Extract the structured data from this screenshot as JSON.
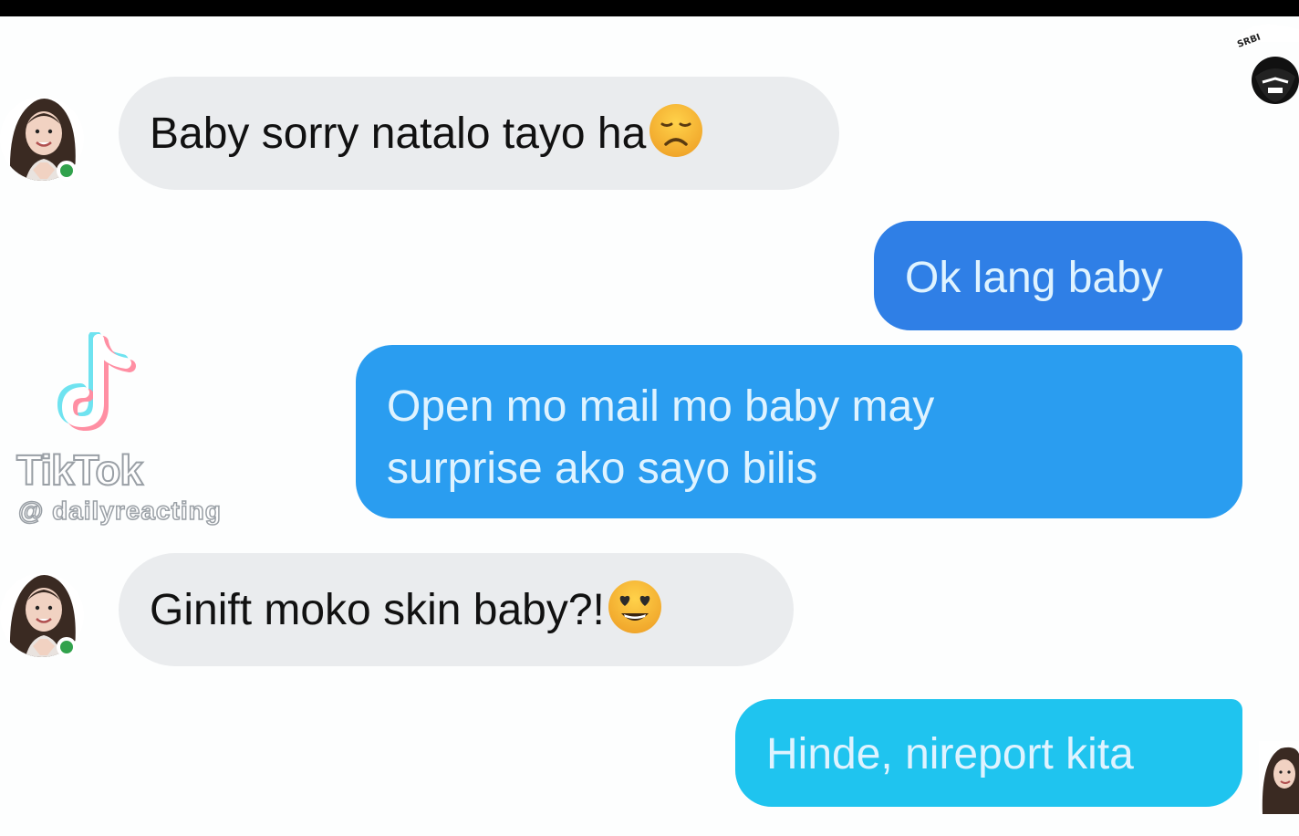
{
  "messages": [
    {
      "side": "received",
      "text": "Baby sorry natalo tayo ha",
      "emoji": "disappointed-face"
    },
    {
      "side": "sent",
      "text": "Ok lang baby"
    },
    {
      "side": "sent",
      "line1": "Open mo mail mo baby may",
      "line2": "surprise ako sayo bilis"
    },
    {
      "side": "received",
      "text": "Ginift moko skin baby?!",
      "emoji": "heart-eyes-face"
    },
    {
      "side": "sent",
      "text": "Hinde, nireport kita"
    }
  ],
  "watermark": {
    "brand": "TikTok",
    "handle": "@ dailyreacting"
  },
  "colors": {
    "received_bubble": "#eaecee",
    "sent_bubble_1": "#2f7fe6",
    "sent_bubble_2": "#2a9df0",
    "sent_bubble_3": "#1fc4ef",
    "presence": "#31a24c"
  },
  "icons": {
    "avatar": "contact-avatar-icon",
    "presence": "online-presence-icon",
    "tiktok": "tiktok-logo-icon",
    "corner": "creator-logo-icon"
  }
}
